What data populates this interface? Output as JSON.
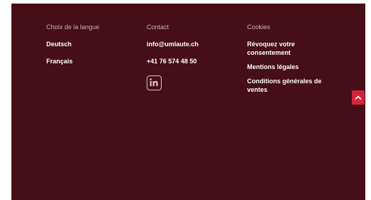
{
  "language": {
    "heading": "Choix de la langue",
    "items": [
      "Deutsch",
      "Français"
    ]
  },
  "contact": {
    "heading": "Contact",
    "email": "info@umlaute.ch",
    "phone": "+41 76 574 48 50",
    "social_icon": "linkedin-icon"
  },
  "cookies": {
    "heading": "Cookies",
    "items": [
      "Révoquez votre consentement",
      "Mentions légales",
      "Conditions générales de ventes"
    ]
  },
  "scroll_top": {
    "icon": "chevron-up-icon",
    "color": "#d5243a"
  },
  "colors": {
    "footer_background": "#450e19",
    "heading_text": "#c9b2b6",
    "link_text": "#ffffff"
  }
}
